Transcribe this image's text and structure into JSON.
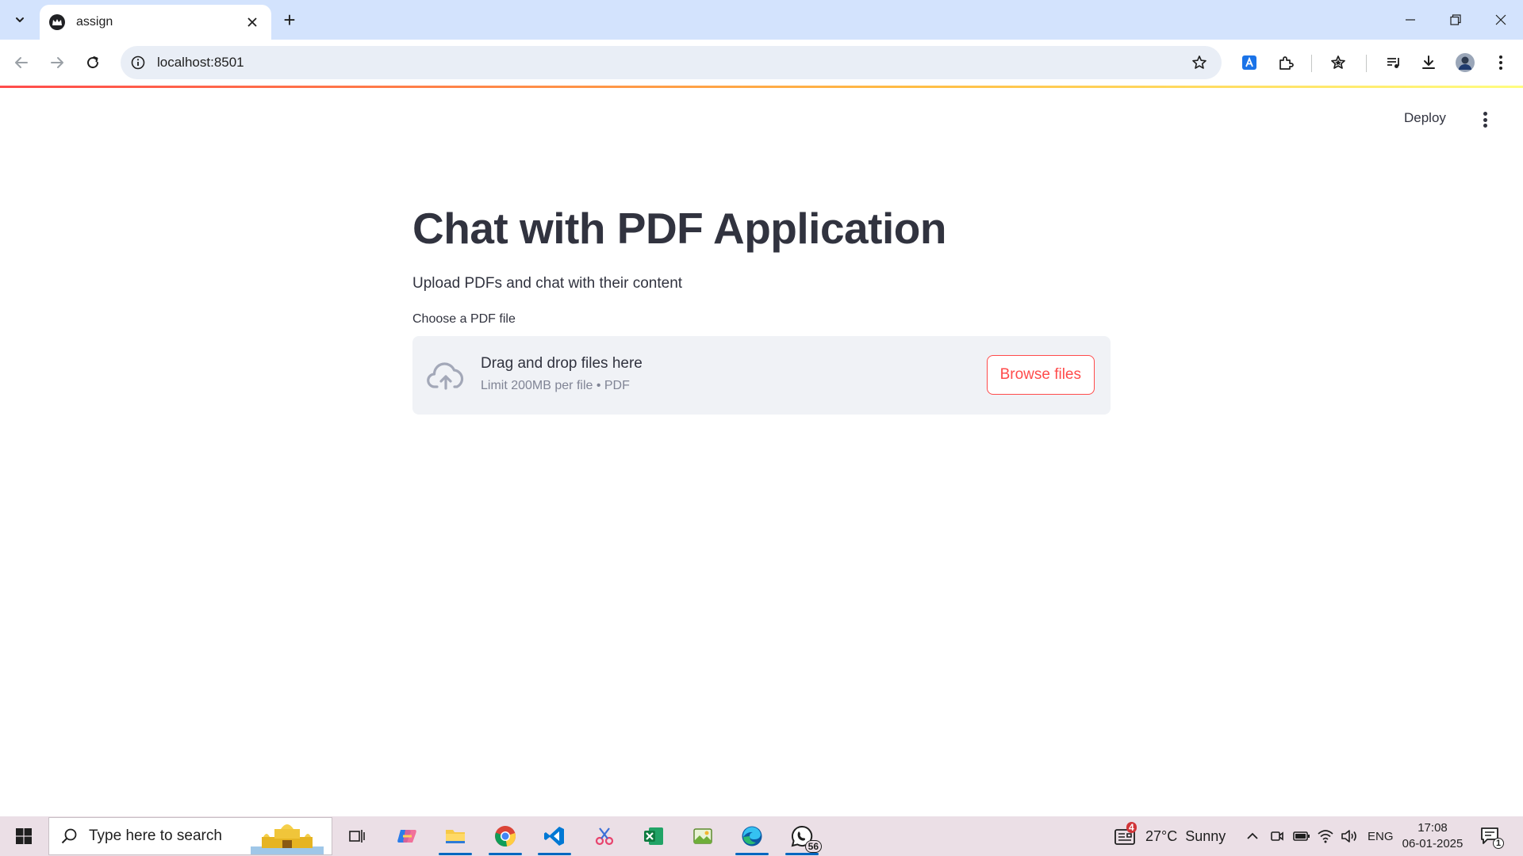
{
  "browser": {
    "tab_title": "assign",
    "new_tab": "+",
    "url": "localhost:8501"
  },
  "app": {
    "deploy_label": "Deploy",
    "title": "Chat with PDF Application",
    "subtitle": "Upload PDFs and chat with their content",
    "uploader": {
      "label": "Choose a PDF file",
      "drop_text": "Drag and drop files here",
      "limit_text": "Limit 200MB per file • PDF",
      "browse_label": "Browse files"
    },
    "colors": {
      "accent": "#ff4b4b",
      "text": "#31333f",
      "dropzone_bg": "#f0f2f6"
    }
  },
  "taskbar": {
    "search_placeholder": "Type here to search",
    "apps": [
      "task-view-icon",
      "copilot-icon",
      "file-explorer-icon",
      "chrome-icon",
      "vscode-icon",
      "snipping-tool-icon",
      "excel-icon",
      "photos-icon",
      "edge-icon",
      "whatsapp-icon"
    ],
    "whatsapp_badge": "56",
    "weather_badge": "4",
    "weather": "27°C  Sunny",
    "language": "ENG",
    "time": "17:08",
    "date": "06-01-2025",
    "notifications": "1"
  }
}
